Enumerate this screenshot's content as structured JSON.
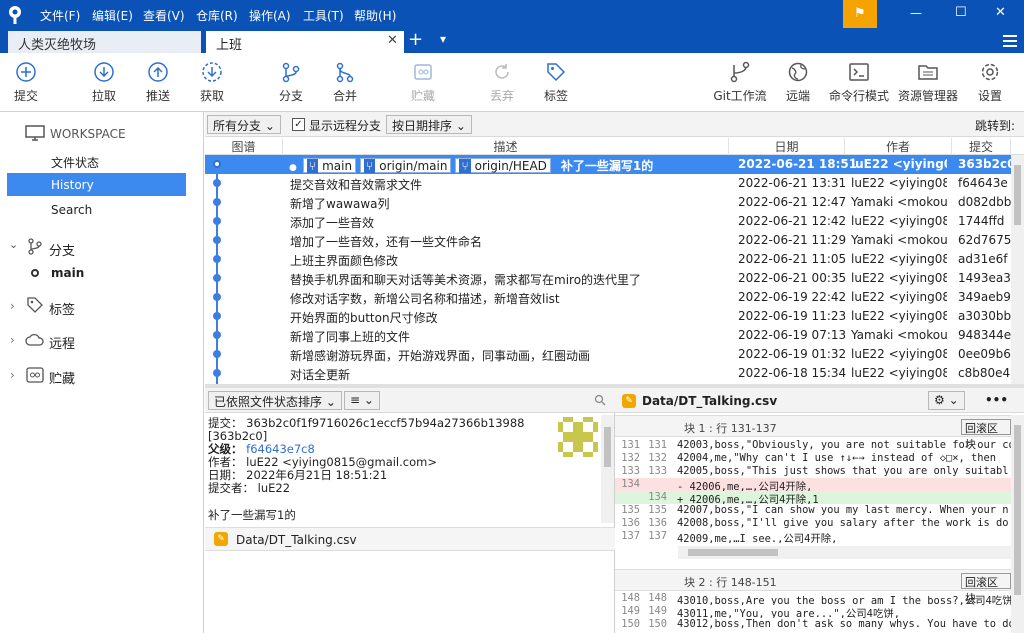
{
  "menu": [
    "文件(F)",
    "编辑(E)",
    "查看(V)",
    "仓库(R)",
    "操作(A)",
    "工具(T)",
    "帮助(H)"
  ],
  "tabs": {
    "first": "人类灭绝牧场",
    "second": "上班",
    "close": "✕",
    "add": "+",
    "dropdown": "▾"
  },
  "window": {
    "min": "—",
    "max": "☐",
    "close": "✕",
    "flag": "⚑"
  },
  "toolbar": {
    "commit": "提交",
    "pull": "拉取",
    "push": "推送",
    "fetch": "获取",
    "branch": "分支",
    "merge": "合并",
    "stash": "贮藏",
    "discard": "丢弃",
    "tag": "标签",
    "gitflow": "Git工作流",
    "remote": "远端",
    "terminal": "命令行模式",
    "explorer": "资源管理器",
    "settings": "设置"
  },
  "sidebar": {
    "workspace": "WORKSPACE",
    "file_status": "文件状态",
    "history": "History",
    "search": "Search",
    "branches": "分支",
    "main_branch": "main",
    "tags": "标签",
    "remotes": "远程",
    "stashes": "贮藏"
  },
  "filter": {
    "branches": "所有分支 ⌄",
    "show_remote": "显示远程分支",
    "sort": "按日期排序 ⌄",
    "jump_to": "跳转到:"
  },
  "columns": {
    "graph": "图谱",
    "desc": "描述",
    "date": "日期",
    "author": "作者",
    "commit": "提交"
  },
  "commits": [
    {
      "msg": "补了一些漏写1的",
      "date": "2022-06-21 18:51",
      "author": "luE22 <yiying08",
      "sha": "363b2c0"
    },
    {
      "msg": "提交音效和音效需求文件",
      "date": "2022-06-21 13:31",
      "author": "luE22 <yiying081",
      "sha": "f64643e"
    },
    {
      "msg": "新增了wawawa列",
      "date": "2022-06-21 12:47",
      "author": "Yamaki <mokou2",
      "sha": "d082dbb"
    },
    {
      "msg": "添加了一些音效",
      "date": "2022-06-21 12:42",
      "author": "luE22 <yiying081",
      "sha": "1744ffd"
    },
    {
      "msg": "增加了一些音效，还有一些文件命名",
      "date": "2022-06-21 11:29",
      "author": "Yamaki <mokou2",
      "sha": "62d7675"
    },
    {
      "msg": "上班主界面颜色修改",
      "date": "2022-06-21 11:05",
      "author": "luE22 <yiying081",
      "sha": "ad31e6f"
    },
    {
      "msg": "替换手机界面和聊天对话等美术资源，需求都写在miro的迭代里了",
      "date": "2022-06-21 00:35",
      "author": "luE22 <yiying081",
      "sha": "1493ea3"
    },
    {
      "msg": "修改对话字数，新增公司名称和描述，新增音效list",
      "date": "2022-06-19 22:42",
      "author": "luE22 <yiying081",
      "sha": "349aeb9"
    },
    {
      "msg": "开始界面的button尺寸修改",
      "date": "2022-06-19 11:23",
      "author": "luE22 <yiying081",
      "sha": "a3030bb"
    },
    {
      "msg": "新增了同事上班的文件",
      "date": "2022-06-19 07:13",
      "author": "Yamaki <mokou2",
      "sha": "948344e"
    },
    {
      "msg": "新增感谢游玩界面，开始游戏界面，同事动画，红圈动画",
      "date": "2022-06-19 01:32",
      "author": "luE22 <yiying081",
      "sha": "0ee09b6"
    },
    {
      "msg": "对话全更新",
      "date": "2022-06-18 15:34",
      "author": "luE22 <yiying081",
      "sha": "c8b80e4"
    }
  ],
  "refs": {
    "main": "main",
    "origin_main": "origin/main",
    "origin_head": "origin/HEAD"
  },
  "detail": {
    "sort_combo": "已依照文件状态排序 ⌄",
    "view_combo": "≡ ⌄",
    "commit_line": "提交： 363b2c0f1f9716026c1eccf57b94a27366b13988",
    "short_sha": "[363b2c0]",
    "parent_label": "父级：",
    "parent_sha": "f64643e7c8",
    "author_line": "作者： luE22 <yiying0815@gmail.com>",
    "date_line": "日期： 2022年6月21日 18:51:21",
    "committer_line": "提交者： luE22",
    "message": "补了一些漏写1的",
    "file": "Data/DT_Talking.csv"
  },
  "diff": {
    "file": "Data/DT_Talking.csv",
    "hunk1_title": "块 1 : 行 131-137",
    "hunk2_title": "块 2 : 行 148-151",
    "revert": "回滚区块",
    "more": "•••",
    "hunk1": [
      {
        "n1": "131",
        "n2": "131",
        "t": "  42003,boss,\"Obviously, you are not suitable for our co",
        "k": ""
      },
      {
        "n1": "132",
        "n2": "132",
        "t": "  42004,me,\"Why can't I use ↑↓←→ instead of ◇□×, then",
        "k": ""
      },
      {
        "n1": "133",
        "n2": "133",
        "t": "  42005,boss,\"This just shows that you are only suitabl",
        "k": ""
      },
      {
        "n1": "134",
        "n2": "",
        "t": "- 42006,me,…,公司4开除,",
        "k": "del"
      },
      {
        "n1": "",
        "n2": "134",
        "t": "+ 42006,me,…,公司4开除,1",
        "k": "add"
      },
      {
        "n1": "135",
        "n2": "135",
        "t": "  42007,boss,\"I can show you my last mercy. When your n",
        "k": ""
      },
      {
        "n1": "136",
        "n2": "136",
        "t": "  42008,boss,\"I'll give you salary after the work is do",
        "k": ""
      },
      {
        "n1": "137",
        "n2": "137",
        "t": "  42009,me,…I see.,公司4开除,",
        "k": ""
      }
    ],
    "hunk2": [
      {
        "n1": "148",
        "n2": "148",
        "t": "  43010,boss,Are you the boss or am I the boss?,公司4吃饼",
        "k": ""
      },
      {
        "n1": "149",
        "n2": "149",
        "t": "  43011,me,\"You, you are...\",公司4吃饼,",
        "k": ""
      },
      {
        "n1": "150",
        "n2": "150",
        "t": "  43012,boss,Then don't ask so many whys. You have to do",
        "k": ""
      }
    ]
  },
  "colors": {
    "titlebar": "#0a52b5",
    "accent": "#3c8af0",
    "flag": "#f5a300",
    "file_icon": "#f0a800"
  }
}
